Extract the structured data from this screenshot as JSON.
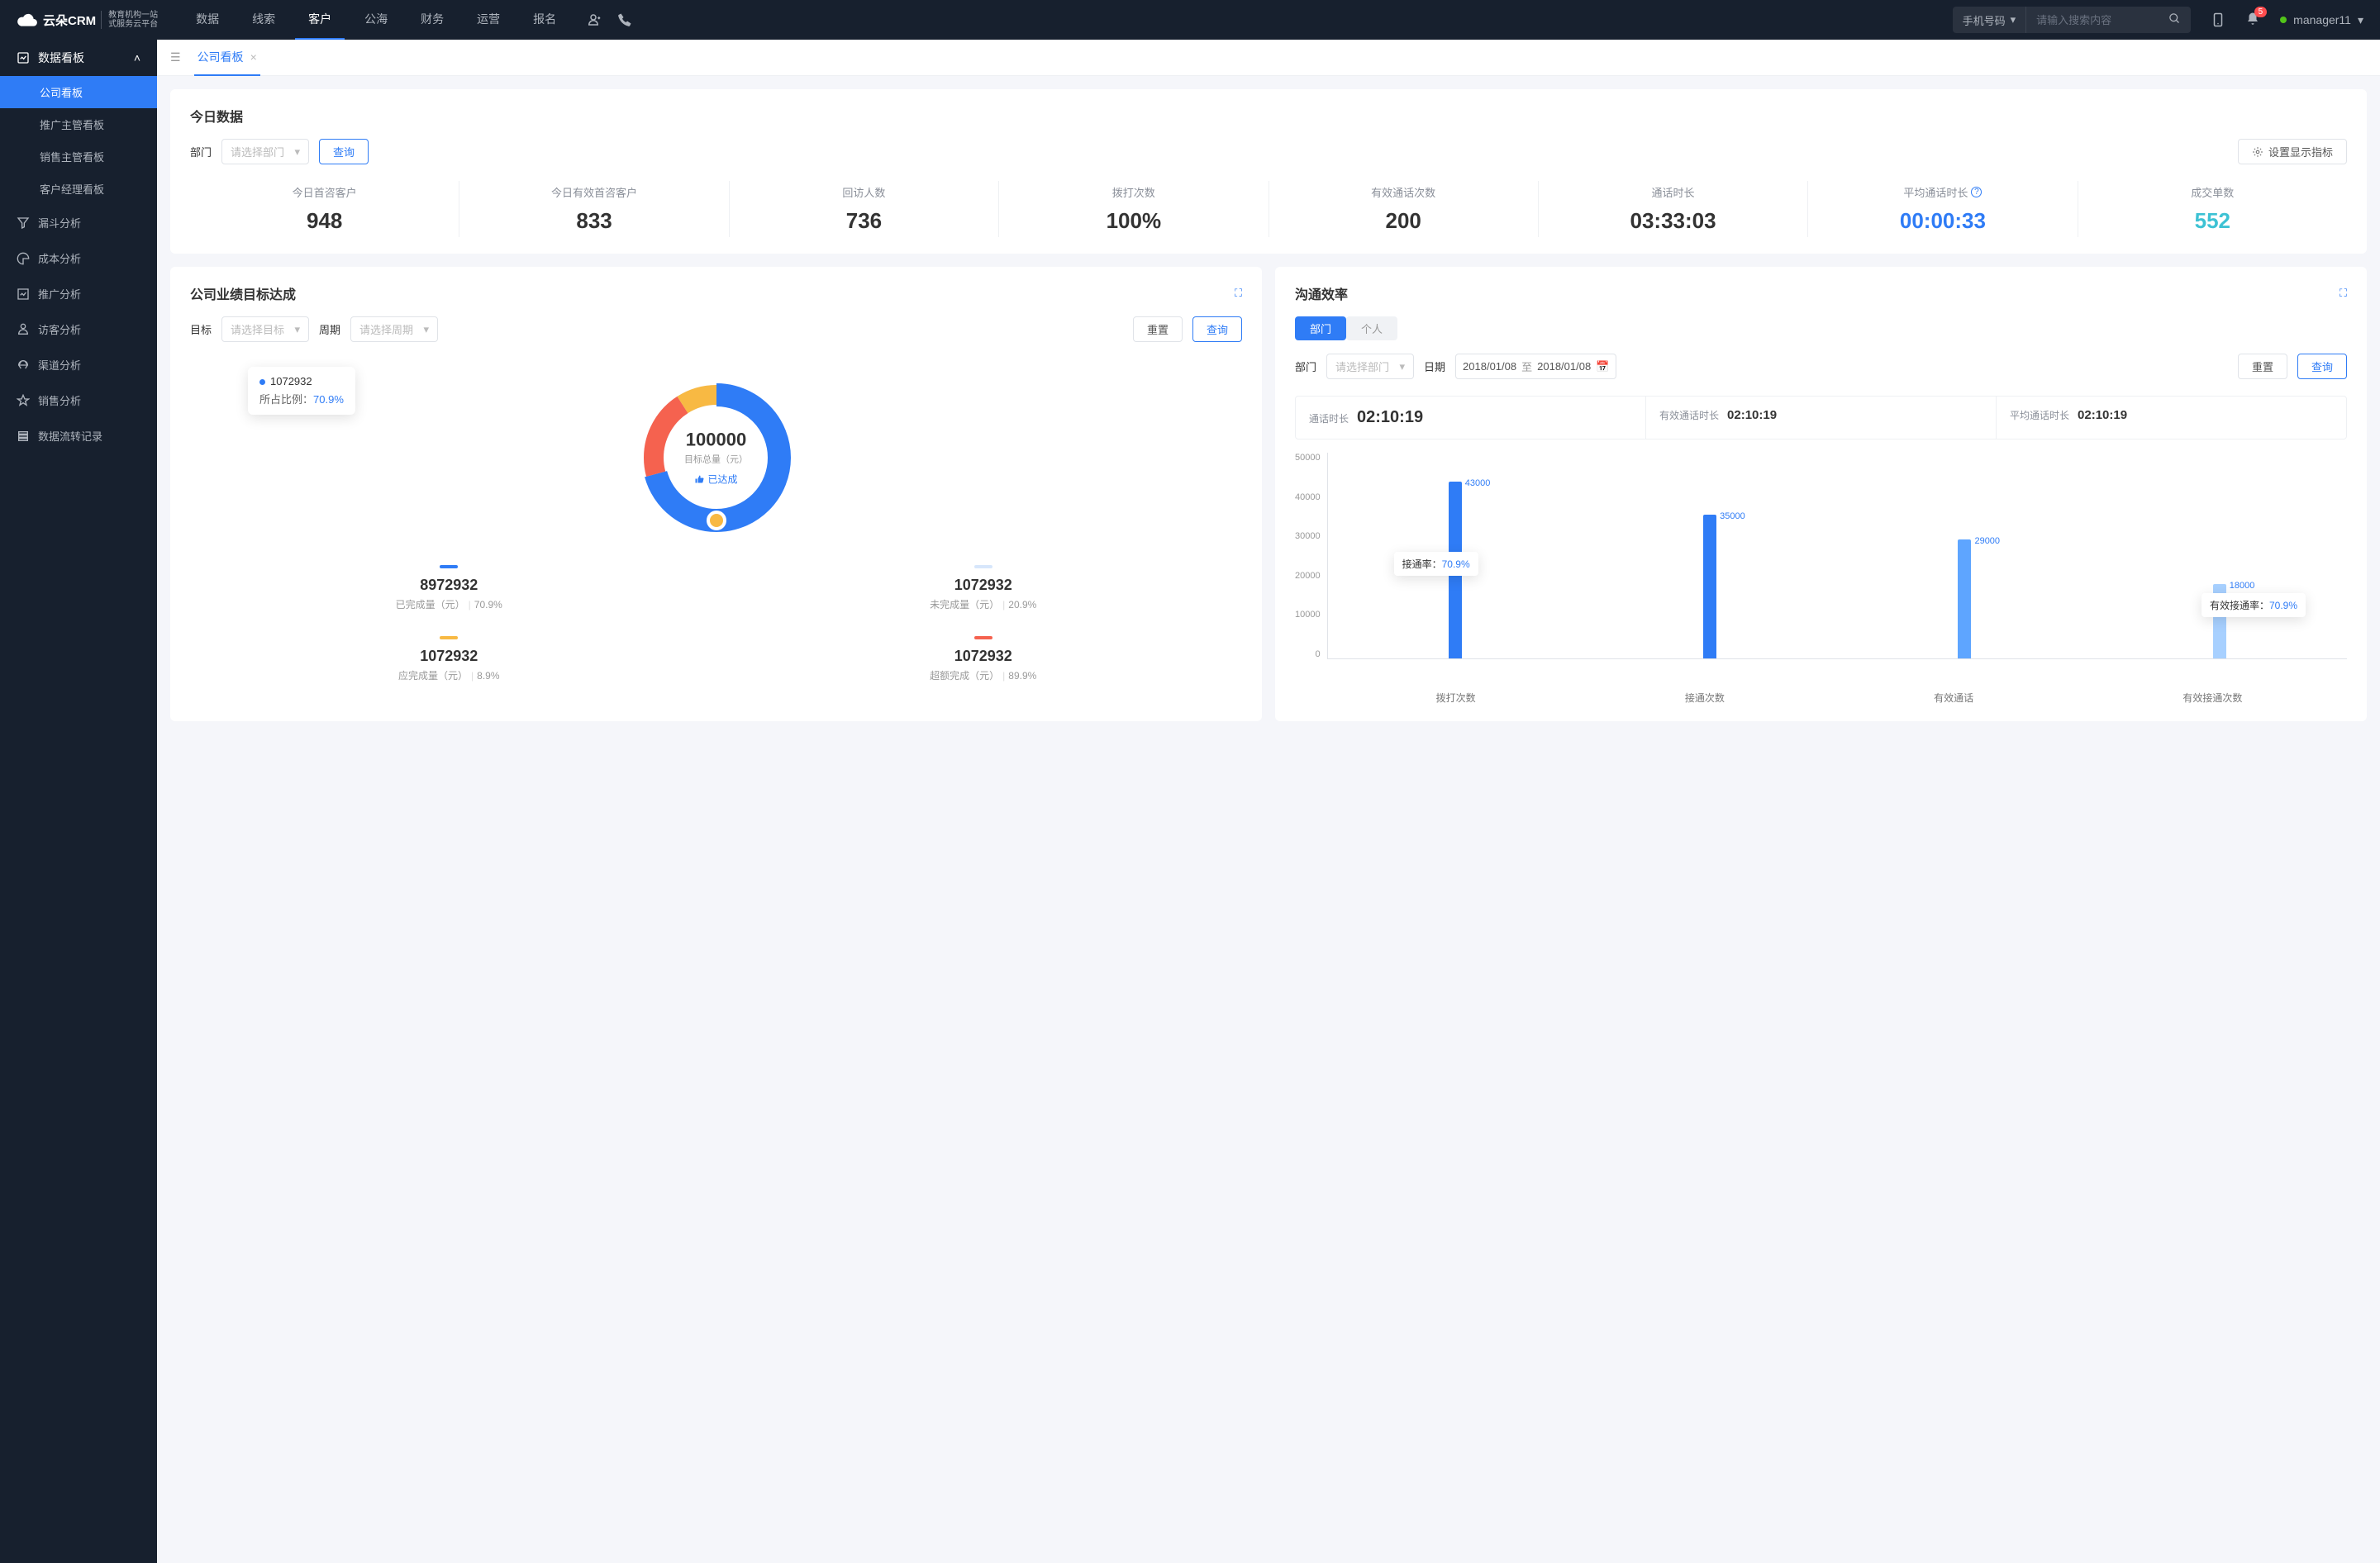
{
  "header": {
    "logo_main": "云朵CRM",
    "logo_sub1": "教育机构一站",
    "logo_sub2": "式服务云平台",
    "nav": [
      "数据",
      "线索",
      "客户",
      "公海",
      "财务",
      "运营",
      "报名"
    ],
    "nav_active": 2,
    "search_type": "手机号码",
    "search_placeholder": "请输入搜索内容",
    "notif_count": "5",
    "user_name": "manager11"
  },
  "sidebar": {
    "group_title": "数据看板",
    "group_items": [
      "公司看板",
      "推广主管看板",
      "销售主管看板",
      "客户经理看板"
    ],
    "group_active": 0,
    "items": [
      "漏斗分析",
      "成本分析",
      "推广分析",
      "访客分析",
      "渠道分析",
      "销售分析",
      "数据流转记录"
    ]
  },
  "tab": {
    "label": "公司看板"
  },
  "today": {
    "title": "今日数据",
    "dept_label": "部门",
    "dept_placeholder": "请选择部门",
    "query_btn": "查询",
    "settings_btn": "设置显示指标",
    "metrics": [
      {
        "label": "今日首咨客户",
        "value": "948",
        "color": "#333"
      },
      {
        "label": "今日有效首咨客户",
        "value": "833",
        "color": "#333"
      },
      {
        "label": "回访人数",
        "value": "736",
        "color": "#333"
      },
      {
        "label": "拨打次数",
        "value": "100%",
        "color": "#333"
      },
      {
        "label": "有效通话次数",
        "value": "200",
        "color": "#333"
      },
      {
        "label": "通话时长",
        "value": "03:33:03",
        "color": "#333"
      },
      {
        "label": "平均通话时长",
        "value": "00:00:33",
        "color": "#2f7cf6",
        "help": true
      },
      {
        "label": "成交单数",
        "value": "552",
        "color": "#3dc2d4"
      }
    ]
  },
  "performance": {
    "title": "公司业绩目标达成",
    "target_label": "目标",
    "target_placeholder": "请选择目标",
    "period_label": "周期",
    "period_placeholder": "请选择周期",
    "reset_btn": "重置",
    "query_btn": "查询",
    "donut_center_value": "100000",
    "donut_center_label": "目标总量（元）",
    "donut_status": "已达成",
    "tooltip_value": "1072932",
    "tooltip_ratio_label": "所占比例：",
    "tooltip_ratio": "70.9%",
    "legend": [
      {
        "color": "#2f7cf6",
        "value": "8972932",
        "label": "已完成量（元）",
        "pct": "70.9%"
      },
      {
        "color": "#d7e6fb",
        "value": "1072932",
        "label": "未完成量（元）",
        "pct": "20.9%"
      },
      {
        "color": "#f8b943",
        "value": "1072932",
        "label": "应完成量（元）",
        "pct": "8.9%"
      },
      {
        "color": "#f5624f",
        "value": "1072932",
        "label": "超额完成（元）",
        "pct": "89.9%"
      }
    ]
  },
  "comm": {
    "title": "沟通效率",
    "pill_dept": "部门",
    "pill_person": "个人",
    "dept_label": "部门",
    "dept_placeholder": "请选择部门",
    "date_label": "日期",
    "date_from": "2018/01/08",
    "date_sep": "至",
    "date_to": "2018/01/08",
    "reset_btn": "重置",
    "query_btn": "查询",
    "stats": [
      {
        "label": "通话时长",
        "value": "02:10:19",
        "big": true
      },
      {
        "label": "有效通话时长",
        "value": "02:10:19"
      },
      {
        "label": "平均通话时长",
        "value": "02:10:19"
      }
    ],
    "tooltip1_label": "接通率：",
    "tooltip1_value": "70.9%",
    "tooltip2_label": "有效接通率：",
    "tooltip2_value": "70.9%"
  },
  "chart_data": {
    "type": "bar",
    "categories": [
      "拨打次数",
      "接通次数",
      "有效通话",
      "有效接通次数"
    ],
    "series": [
      {
        "name": "calls",
        "values": [
          43000,
          35000,
          29000,
          18000
        ],
        "colors": [
          "#2f7cf6",
          "#2f7cf6",
          "#5ea5ff",
          "#a7d0ff"
        ]
      }
    ],
    "ylim": [
      0,
      50000
    ],
    "yticks": [
      0,
      10000,
      20000,
      30000,
      40000,
      50000
    ],
    "annotations": [
      {
        "category": "接通次数",
        "label": "接通率：",
        "value": "70.9%"
      },
      {
        "category": "有效接通次数",
        "label": "有效接通率：",
        "value": "70.9%"
      }
    ]
  }
}
